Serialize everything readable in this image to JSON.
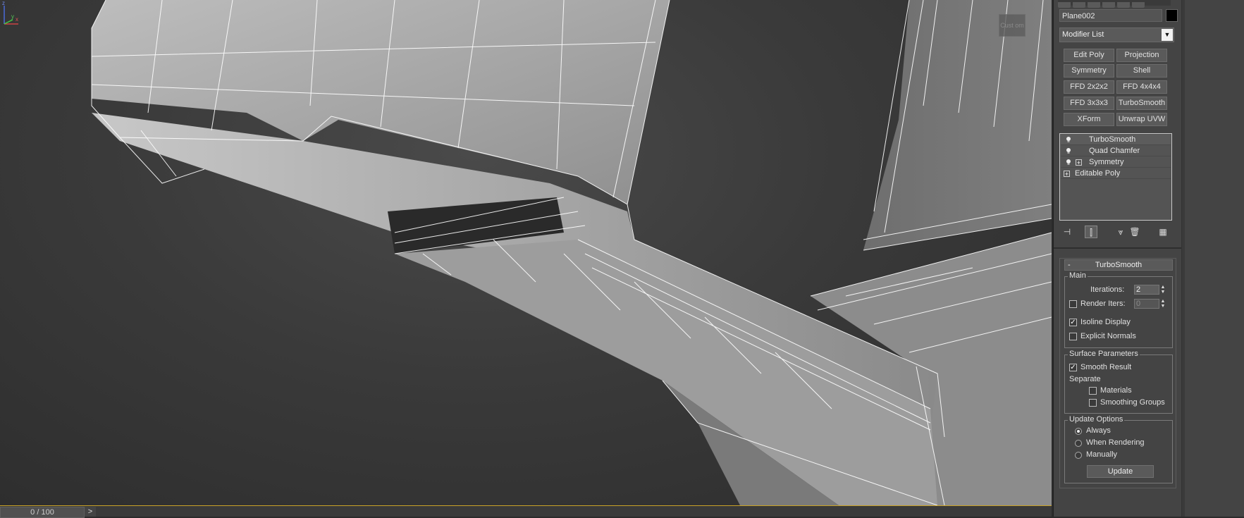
{
  "viewport": {
    "gizmo_label": "Cust om",
    "axes": {
      "x": "x",
      "y": "y",
      "z": "z"
    }
  },
  "timeline": {
    "frame": "0 / 100",
    "next": ">"
  },
  "panel": {
    "object_name": "Plane002",
    "object_color": "#000000",
    "modifier_list": "Modifier List",
    "modifier_buttons": [
      "Edit Poly",
      "Projection",
      "Symmetry",
      "Shell",
      "FFD 2x2x2",
      "FFD 4x4x4",
      "FFD 3x3x3",
      "TurboSmooth",
      "XForm",
      "Unwrap UVW"
    ],
    "stack": [
      {
        "label": "TurboSmooth",
        "icon": "light-bulb-icon",
        "expand": ""
      },
      {
        "label": "Quad Chamfer",
        "icon": "light-bulb-icon",
        "expand": ""
      },
      {
        "label": "Symmetry",
        "icon": "light-bulb-icon",
        "expand": "+"
      },
      {
        "label": "Editable Poly",
        "icon": "",
        "expand": "+"
      }
    ],
    "stack_tools": [
      "pin-stack-icon",
      "show-end-result-icon",
      "make-unique-icon",
      "remove-modifier-icon",
      "configure-sets-icon"
    ]
  },
  "turbosmooth": {
    "title": "TurboSmooth",
    "collapse": "-",
    "main": {
      "group": "Main",
      "iterations_label": "Iterations:",
      "iterations_value": "2",
      "render_iters_label": "Render Iters:",
      "render_iters_value": "0",
      "render_iters_checked": false,
      "isoline_label": "Isoline Display",
      "isoline_checked": true,
      "explicit_label": "Explicit Normals",
      "explicit_checked": false
    },
    "surface": {
      "group": "Surface Parameters",
      "smooth_label": "Smooth Result",
      "smooth_checked": true,
      "separate_label": "Separate",
      "materials_label": "Materials",
      "materials_checked": false,
      "smoothing_label": "Smoothing Groups",
      "smoothing_checked": false
    },
    "update": {
      "group": "Update Options",
      "options": [
        "Always",
        "When Rendering",
        "Manually"
      ],
      "selected": "Always",
      "button": "Update"
    }
  }
}
